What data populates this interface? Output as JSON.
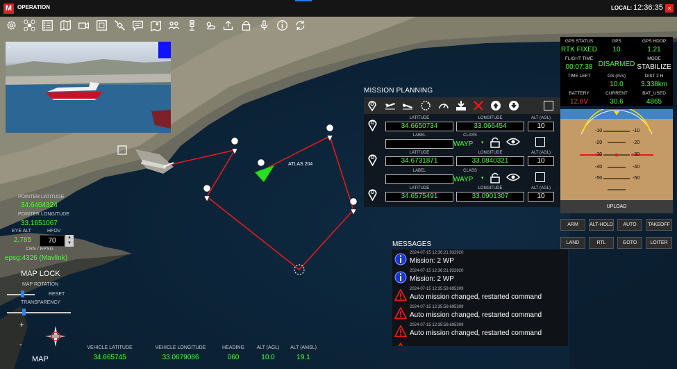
{
  "app": {
    "logo": "M",
    "title": "OPERATION",
    "local_label": "LOCAL:",
    "time": "12:36:35",
    "close": "×"
  },
  "toolbar": [
    "gear-icon",
    "drone-icon",
    "checklist-icon",
    "map-icon",
    "camera-icon",
    "frame-icon",
    "satellite-icon",
    "chat-icon",
    "map-pin-icon",
    "group-icon",
    "antenna-icon",
    "weather-icon",
    "upload-icon",
    "lock-icon",
    "audio-icon",
    "info-icon",
    "sync-icon"
  ],
  "left_panel": {
    "pointer_lat_label": "POINTER LATITUDE",
    "pointer_lat": "34.6404324",
    "pointer_lon_label": "POINTER LONGITUDE",
    "pointer_lon": "33.1651067",
    "eye_alt_label": "EYE ALT",
    "eye_alt": "2,785",
    "hfov_label": "HFOV",
    "hfov": "70",
    "crs_label": "CRS / EPSG",
    "crs": "epsg:4326 (Mavlink)",
    "map_lock": "MAP LOCK",
    "map_rotation": "MAP ROTATION",
    "reset": "RESET",
    "transparency": "TRANSPARENCY",
    "plus": "+",
    "minus": "-",
    "map": "MAP"
  },
  "map_labels": {
    "vehicle": "ATLAS 204"
  },
  "mission": {
    "title": "MISSION PLANNING",
    "col_lat": "LATITUDE",
    "col_lon": "LONGITUDE",
    "col_alt": "ALT (AGL)",
    "col_label": "LABEL",
    "col_class": "CLASS",
    "waypoints": [
      {
        "lat": "34.6650734",
        "lon": "33.066454",
        "alt": "10",
        "class": "WAYP"
      },
      {
        "lat": "34.6731871",
        "lon": "33.0840321",
        "alt": "10",
        "class": "WAYP"
      },
      {
        "lat": "34.6575491",
        "lon": "33.0901307",
        "alt": "10"
      }
    ]
  },
  "messages": {
    "title": "MESSAGES",
    "items": [
      {
        "time": "2024-07-15 12:36:21.932920",
        "text": "Mission: 2 WP",
        "type": "info"
      },
      {
        "time": "2024-07-15 12:36:21.932920",
        "text": "Mission: 2 WP",
        "type": "info"
      },
      {
        "time": "2024-07-15 12:35:59.695309",
        "text": "Auto mission changed, restarted command",
        "type": "warn"
      },
      {
        "time": "2024-07-15 12:35:59.695309",
        "text": "Auto mission changed, restarted command",
        "type": "warn"
      },
      {
        "time": "2024-07-15 12:35:59.695309",
        "text": "Auto mission changed, restarted command",
        "type": "warn"
      }
    ]
  },
  "status": {
    "gps_status_label": "GPS STATUS",
    "gps_status": "RTK FIXED",
    "gps_label": "GPS",
    "gps": "10",
    "hdop_label": "GPS HDOP",
    "hdop": "1.21",
    "flight_time_label": "FLIGHT TIME",
    "flight_time": "00:07:38",
    "armed": "DISARMED",
    "mode_label": "MODE",
    "mode": "STABILIZE",
    "time_left_label": "TIME LEFT",
    "gs_label": "GS (m/s)",
    "gs": "10.0",
    "dist_label": "DIST 2 H",
    "dist": "3.338km",
    "battery_label": "BATTERY",
    "battery": "12.6V",
    "current_label": "CURRENT",
    "current": "30.6",
    "bat_used_label": "BAT_USED",
    "bat_used": "4865"
  },
  "attitude": {
    "ticks": [
      "-10",
      "-20",
      "-30",
      "-40",
      "-50"
    ]
  },
  "upload": "UPLOAD",
  "commands": [
    "ARM",
    "ALT-HOLD",
    "AUTO",
    "TAKEOFF",
    "LAND",
    "RTL",
    "GOTO",
    "LOITER"
  ],
  "bottom": {
    "veh_lat_label": "VEHICLE LATITUDE",
    "veh_lat": "34.665745",
    "veh_lon_label": "VEHICLE LONGITUDE",
    "veh_lon": "33.0679086",
    "heading_label": "HEADING",
    "heading": "060",
    "alt_agl_label": "ALT (AGL)",
    "alt_agl": "10.0",
    "alt_amsl_label": "ALT (AMSL)",
    "alt_amsl": "19.1"
  },
  "colors": {
    "accent_green": "#4cff3c",
    "route_red": "#e21b1b",
    "alert_red": "#e0221e"
  }
}
